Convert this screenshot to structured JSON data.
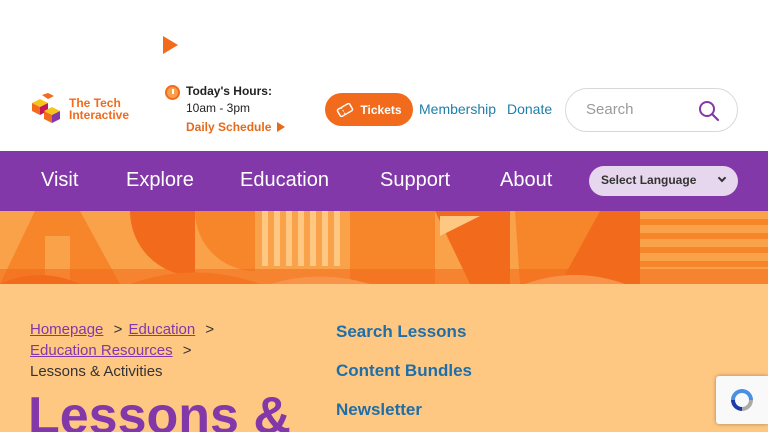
{
  "header": {
    "logo_text": "The Tech Interactive",
    "hours_title": "Today's Hours:",
    "hours_time": "10am - 3pm",
    "schedule_link": "Daily Schedule",
    "tickets_label": "Tickets",
    "membership_label": "Membership",
    "donate_label": "Donate",
    "search_placeholder": "Search"
  },
  "nav": {
    "items": [
      "Visit",
      "Explore",
      "Education",
      "Support",
      "About"
    ],
    "language_label": "Select Language"
  },
  "breadcrumb": {
    "homepage": "Homepage",
    "education": "Education",
    "education_resources": "Education Resources",
    "current": "Lessons & Activities",
    "separator": ">"
  },
  "main": {
    "title": "Lessons &"
  },
  "sidebar": {
    "links": [
      "Search Lessons",
      "Content Bundles",
      "Newsletter"
    ]
  },
  "colors": {
    "orange": "#f26a1b",
    "purple": "#8338a9",
    "blue": "#1f7fa8",
    "peach": "#ffc882"
  }
}
